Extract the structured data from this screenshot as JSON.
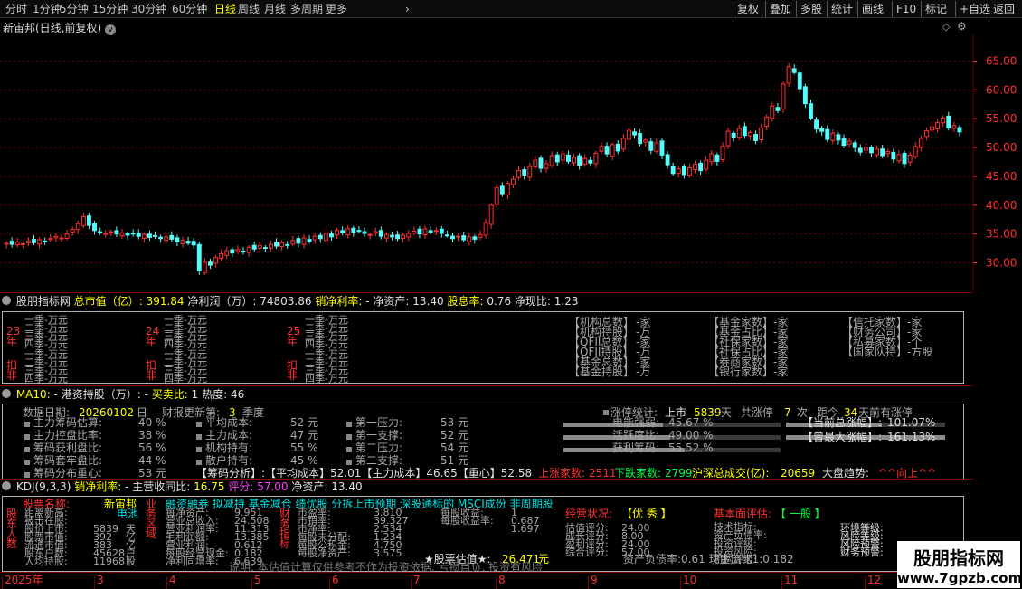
{
  "toolbar": {
    "periods": [
      "分时",
      "1分钟",
      "5分钟",
      "15分钟",
      "30分钟",
      "60分钟",
      "日线",
      "周线",
      "月线",
      "多周期",
      "更多"
    ],
    "more_arrow": "›",
    "right": [
      "复权",
      "叠加",
      "多股",
      "统计",
      "画线",
      "F10",
      "标记",
      "+自选",
      "返回"
    ]
  },
  "chart": {
    "title": "新宙邦(日线,前复权)",
    "price_ticks": [
      "65.00",
      "60.00",
      "55.00",
      "50.00",
      "45.00",
      "40.00",
      "35.00",
      "30.00"
    ],
    "closes": [
      33.4,
      33.2,
      33.6,
      33.3,
      33.8,
      33.5,
      34.0,
      33.7,
      34.2,
      34.6,
      34.3,
      35.0,
      35.8,
      36.8,
      38.0,
      36.5,
      35.6,
      35.3,
      35.1,
      35.4,
      35.0,
      35.2,
      34.8,
      35.1,
      34.6,
      34.9,
      34.4,
      34.6,
      34.2,
      34.5,
      34.1,
      33.6,
      33.9,
      33.4,
      33.1,
      28.6,
      30.1,
      29.6,
      30.9,
      31.6,
      32.1,
      31.7,
      32.3,
      32.0,
      32.7,
      32.4,
      33.0,
      32.6,
      33.2,
      32.9,
      33.5,
      33.1,
      33.9,
      33.4,
      34.3,
      33.7,
      34.6,
      34.2,
      35.1,
      34.5,
      35.6,
      35.2,
      35.9,
      35.3,
      35.6,
      35.1,
      34.9,
      35.4,
      34.6,
      34.9,
      34.5,
      34.2,
      34.8,
      35.1,
      35.5,
      35.0,
      35.9,
      35.3,
      35.6,
      35.1,
      34.8,
      34.2,
      34.6,
      34.0,
      34.5,
      34.1,
      34.9,
      37.0,
      40.0,
      43.0,
      42.0,
      43.8,
      44.5,
      46.0,
      45.2,
      46.7,
      47.8,
      46.4,
      47.2,
      48.6,
      47.5,
      48.9,
      47.6,
      48.3,
      46.9,
      48.1,
      47.3,
      49.0,
      50.2,
      48.9,
      50.5,
      49.4,
      51.6,
      53.0,
      52.2,
      50.7,
      51.3,
      49.5,
      50.8,
      48.7,
      47.0,
      45.5,
      46.3,
      45.3,
      46.5,
      47.1,
      46.0,
      47.8,
      48.9,
      47.6,
      50.2,
      52.8,
      51.8,
      53.3,
      52.1,
      52.6,
      51.2,
      53.4,
      55.3,
      57.2,
      56.4,
      61.0,
      64.0,
      63.0,
      60.2,
      57.6,
      55.1,
      53.2,
      52.8,
      51.4,
      52.5,
      51.3,
      50.4,
      51.1,
      50.0,
      49.2,
      50.0,
      49.1,
      49.7,
      48.6,
      49.3,
      48.0,
      48.8,
      47.2,
      48.7,
      50.2,
      51.6,
      52.9,
      53.6,
      54.3,
      55.1,
      53.4,
      53.8,
      52.7
    ],
    "x_labels": [
      "2025年",
      "3",
      "4",
      "5",
      "6",
      "7",
      "8",
      "9",
      "10",
      "11",
      "12"
    ]
  },
  "indicator": {
    "title": "股朋指标网",
    "cap_label": "总市值（亿）",
    "cap_val": "391.84",
    "profit_label": "净利润（万）",
    "profit_val": "74803.86",
    "margin_label": "销净利率:",
    "margin_val": "-",
    "asset_label": "净资产:",
    "asset_val": "13.40",
    "div_label": "股息率:",
    "div_val": "0.76",
    "pcf_label": "净现比:",
    "pcf_val": "1.23",
    "years": [
      {
        "y": "23",
        "nian": "年",
        "kou": "扣",
        "fei": "非"
      },
      {
        "y": "24",
        "nian": "年",
        "kou": "扣",
        "fei": "非"
      },
      {
        "y": "25",
        "nian": "年",
        "kou": "扣",
        "fei": "非"
      }
    ],
    "quarters": [
      "一季-万元",
      "二季-万元",
      "三季-万元",
      "四季-万元"
    ],
    "mid": [
      [
        "【机构总数】",
        "-家"
      ],
      [
        "【机构持股】",
        "-万"
      ],
      [
        "【QFII总数】",
        "-家"
      ],
      [
        "【QFII持股】",
        "-万"
      ],
      [
        "【基金总数】",
        "-家"
      ],
      [
        "【基金持股】",
        "-万"
      ]
    ],
    "right": [
      [
        "【基金家数】",
        "-家"
      ],
      [
        "【基金占比】",
        "-家"
      ],
      [
        "【社保家数】",
        "-家"
      ],
      [
        "【社保占比】",
        "-家"
      ],
      [
        "【券商家数】",
        "-家"
      ],
      [
        "【银行家数】",
        "-家"
      ]
    ],
    "far": [
      [
        "【信托家数】",
        "-家"
      ],
      [
        "【财务公司】",
        "-家"
      ],
      [
        "【私募家数】",
        "-个"
      ],
      [
        "【国家队持】",
        "-方股"
      ]
    ]
  },
  "hk": {
    "title": "MA10:",
    "v1": "-",
    "lbl": "港资持股（万）:",
    "v2": "-",
    "ratio_lbl": "买卖比:",
    "ratio": "1",
    "heat_lbl": "热度:",
    "heat": "46",
    "date_lbl": "数据日期:",
    "date": "20260102",
    "date_unit": "日",
    "report_lbl": "财报更新第:",
    "report": "3",
    "report_unit": "季度",
    "col1": [
      [
        "主力筹码估算:",
        "40 %"
      ],
      [
        "主力控盘比率:",
        "38 %"
      ],
      [
        "筹码获利盘比:",
        "56 %"
      ],
      [
        "筹码套牢盘比:",
        "44 %"
      ],
      [
        "筹码分布重心:",
        "53 元"
      ]
    ],
    "col2": [
      [
        "平均成本:",
        "52 元"
      ],
      [
        "主力成本:",
        "47 元"
      ],
      [
        "机构持有:",
        "55 %"
      ],
      [
        "散户持有:",
        "45 %"
      ]
    ],
    "col3": [
      [
        "第一压力:",
        "53 元"
      ],
      [
        "第一支撑:",
        "52 元"
      ],
      [
        "第二压力:",
        "54 元"
      ],
      [
        "第二支撑:",
        "51 元"
      ]
    ],
    "chip": "【筹码分析】:【平均成本】52.01【主力成本】46.65【重心】52.58",
    "limit_lbl": "涨停统计:",
    "listed": "上市",
    "listed_days": "5839",
    "days_unit": "天",
    "total_lbl": "共涨停",
    "total": "7",
    "times": "次",
    "dist_lbl": "距今",
    "dist": "34",
    "dist_unit": "天前有涨停",
    "bars": [
      [
        "电能强弱:",
        "45.67 %",
        0.46
      ],
      [
        "活跃度比:",
        "49.00 %",
        0.49
      ],
      [
        "获利筹码:",
        "55.52 %",
        0.56
      ]
    ],
    "cur_lbl": "【当前总涨幅】:",
    "cur": "101.07%",
    "max_lbl": "【曾最大涨幅】:",
    "max": "161.13%",
    "up_lbl": "上涨家数:",
    "up": "2511",
    "down_lbl": "下跌家数:",
    "down": "2799",
    "vol_lbl": "沪深总成交(亿):",
    "vol": "20659",
    "trend_lbl": "大盘趋势:",
    "trend": "^^向上^^"
  },
  "kdj": {
    "title": "KDJ(9,3,3)",
    "m_lbl": "销净利率:",
    "m": "-",
    "rev_lbl": "主营收同比:",
    "rev": "16.75",
    "score_lbl": "评分:",
    "score": "57.00",
    "asset_lbl": "净资产:",
    "asset": "13.40",
    "name_lbl": "股票名称:",
    "name": "新宙邦",
    "industry": "电池",
    "side": [
      "股",
      "东",
      "人",
      "数"
    ],
    "side2": [
      "业",
      "务",
      "区",
      "域"
    ],
    "side3": [
      "财",
      "务",
      "指",
      "标"
    ],
    "tags": "融资融券 拟减持 基金减仓 绩优股 分拆上市预期 深股通标的 MSCI成份 非周期股",
    "left_rows": [
      [
        "距离新高:",
        "",
        ""
      ],
      [
        "被击在股:",
        "",
        ""
      ],
      [
        "股价上市:",
        "5839",
        "天"
      ],
      [
        "股票市值:",
        "392",
        "亿"
      ],
      [
        "流通市值:",
        "383",
        "亿"
      ],
      [
        "股东户数:",
        "45628",
        "户"
      ],
      [
        "人均持股:",
        "11968",
        "股"
      ]
    ],
    "mid_rows": [
      [
        "每净资产:",
        "9.951"
      ],
      [
        "营业总收入:",
        "24.508"
      ],
      [
        "营业利润率:",
        "11.313"
      ],
      [
        "毛利润额:",
        "13.385"
      ],
      [
        "营业利润:",
        "0.612"
      ],
      [
        "每股经营现金:",
        "0.182"
      ],
      [
        "净利同增率:",
        "6.639"
      ]
    ],
    "mid2_rows": [
      [
        "市盈率:",
        "3.810"
      ],
      [
        "市销率:",
        "39.327"
      ],
      [
        "市净率:",
        "2.534"
      ],
      [
        "每股未分配:",
        "1.234"
      ],
      [
        "每股公积金:",
        "4.750"
      ],
      [
        "每股净资产:",
        "3.575"
      ]
    ],
    "mid3": [
      [
        "每股收益:",
        "1"
      ],
      [
        "每股收益率:",
        "0.687"
      ],
      [
        "",
        "1.697"
      ]
    ],
    "status_lbl": "经营状况:",
    "status": "【优 秀 】",
    "fund_lbl": "基本面评估:",
    "fund": "【 一般 】",
    "eval": [
      [
        "估值评分:",
        "24.00"
      ],
      [
        "成长评分:",
        "8.00"
      ],
      [
        "盈利评分:",
        "24.00"
      ],
      [
        "综合评分:",
        "57.00"
      ]
    ],
    "risk": [
      "技术指标:",
      "资产负债率:",
      "投资评级:",
      "投资风险:",
      "机构评级:"
    ],
    "risk2": [
      "环境等级:",
      "风险等级:",
      "风险预警:",
      "财务预警:"
    ],
    "est_lbl": "★股票估值★:",
    "est": "26.471",
    "est_unit": "元",
    "ratio_line": "资产负债率:0.61 现金流比1:0.182",
    "disclaimer": "说明: 本估值计算仅供参考不作为投资依据, 亏损自负, 投资有风险"
  },
  "watermark": {
    "text": "股朋指标网",
    "url": "www.7gpzb.com"
  }
}
